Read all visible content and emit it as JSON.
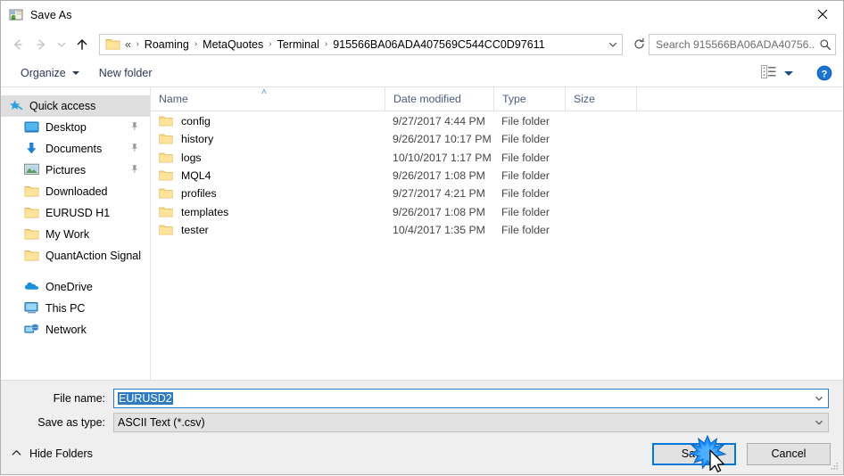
{
  "window": {
    "title": "Save As",
    "app_icon": "save-as-icon",
    "close_label": "✕"
  },
  "nav": {
    "back_icon": "back-arrow-icon",
    "forward_icon": "forward-arrow-icon",
    "recent_icon": "recent-locations-icon",
    "up_icon": "up-arrow-icon",
    "refresh_icon": "refresh-icon",
    "address_dropdown_icon": "chevron-down-icon"
  },
  "address": {
    "folder_icon": "folder-icon",
    "overflow": "«",
    "crumbs": [
      "Roaming",
      "MetaQuotes",
      "Terminal",
      "915566BA06ADA407569C544CC0D97611"
    ],
    "separator": "›"
  },
  "search": {
    "placeholder": "Search 915566BA06ADA40756...",
    "icon": "search-icon"
  },
  "toolbar": {
    "organize_label": "Organize",
    "new_folder_label": "New folder",
    "view_icon": "view-options-icon",
    "help_icon": "help-icon"
  },
  "sidebar": {
    "items": [
      {
        "label": "Quick access",
        "icon": "star-pin-icon",
        "selected": true,
        "pinned": false,
        "indent": 0
      },
      {
        "label": "Desktop",
        "icon": "desktop-icon",
        "selected": false,
        "pinned": true,
        "indent": 1
      },
      {
        "label": "Documents",
        "icon": "documents-icon",
        "selected": false,
        "pinned": true,
        "indent": 1
      },
      {
        "label": "Pictures",
        "icon": "pictures-icon",
        "selected": false,
        "pinned": true,
        "indent": 1
      },
      {
        "label": "Downloaded",
        "icon": "folder-icon",
        "selected": false,
        "pinned": false,
        "indent": 1
      },
      {
        "label": "EURUSD H1",
        "icon": "folder-icon",
        "selected": false,
        "pinned": false,
        "indent": 1
      },
      {
        "label": "My Work",
        "icon": "folder-icon",
        "selected": false,
        "pinned": false,
        "indent": 1
      },
      {
        "label": "QuantAction Signal",
        "icon": "folder-icon",
        "selected": false,
        "pinned": false,
        "indent": 1
      }
    ],
    "groups": [
      {
        "label": "OneDrive",
        "icon": "onedrive-icon"
      },
      {
        "label": "This PC",
        "icon": "this-pc-icon"
      },
      {
        "label": "Network",
        "icon": "network-icon"
      }
    ]
  },
  "filelist": {
    "columns": [
      {
        "key": "name",
        "label": "Name"
      },
      {
        "key": "date",
        "label": "Date modified"
      },
      {
        "key": "type",
        "label": "Type"
      },
      {
        "key": "size",
        "label": "Size"
      }
    ],
    "sort_indicator": "˄",
    "rows": [
      {
        "name": "config",
        "date": "9/27/2017 4:44 PM",
        "type": "File folder",
        "size": "",
        "icon": "folder-icon"
      },
      {
        "name": "history",
        "date": "9/26/2017 10:17 PM",
        "type": "File folder",
        "size": "",
        "icon": "folder-icon"
      },
      {
        "name": "logs",
        "date": "10/10/2017 1:17 PM",
        "type": "File folder",
        "size": "",
        "icon": "folder-icon"
      },
      {
        "name": "MQL4",
        "date": "9/26/2017 1:08 PM",
        "type": "File folder",
        "size": "",
        "icon": "folder-icon"
      },
      {
        "name": "profiles",
        "date": "9/27/2017 4:21 PM",
        "type": "File folder",
        "size": "",
        "icon": "folder-icon"
      },
      {
        "name": "templates",
        "date": "9/26/2017 1:08 PM",
        "type": "File folder",
        "size": "",
        "icon": "folder-icon"
      },
      {
        "name": "tester",
        "date": "10/4/2017 1:35 PM",
        "type": "File folder",
        "size": "",
        "icon": "folder-icon"
      }
    ]
  },
  "form": {
    "filename_label": "File name:",
    "filename_value": "EURUSD2",
    "filetype_label": "Save as type:",
    "filetype_value": "ASCII Text (*.csv)",
    "dropdown_icon": "chevron-down-icon"
  },
  "footer": {
    "hide_folders_label": "Hide Folders",
    "hide_folders_icon": "chevron-up-icon",
    "save_label": "Save",
    "cancel_label": "Cancel",
    "resize_grip_icon": "resize-grip-icon",
    "cursor_icon": "mouse-cursor-icon",
    "click_effect_icon": "click-burst-icon"
  },
  "colors": {
    "accent": "#0078d7",
    "selection": "#2f7ac0",
    "folder": "#fcd77f",
    "sidebar_selected": "#dedede",
    "form_bg": "#efefef"
  }
}
